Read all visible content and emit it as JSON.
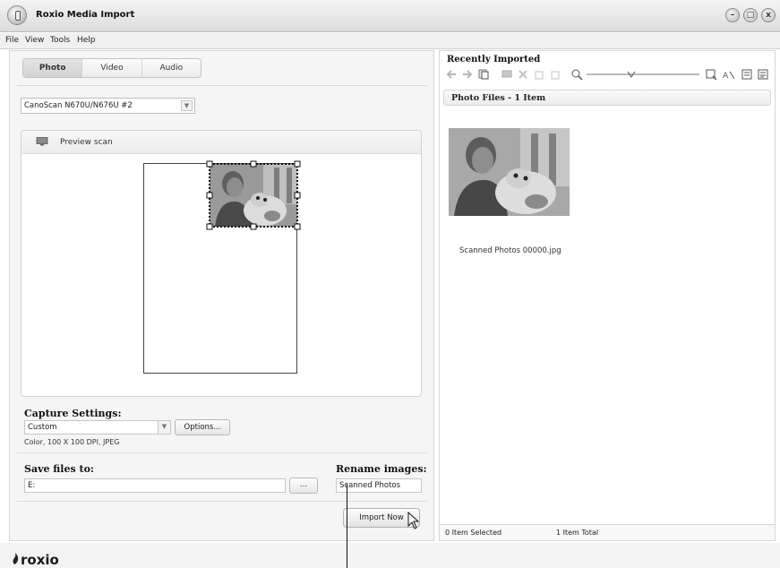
{
  "window": {
    "title": "Roxio Media Import",
    "minimize": "–",
    "maximize": "□",
    "close": "x"
  },
  "menu": [
    "File",
    "View",
    "Tools",
    "Help"
  ],
  "tabs": [
    "Photo",
    "Video",
    "Audio"
  ],
  "device": {
    "selected": "CanoScan N670U/N676U #2",
    "arrow": "▼"
  },
  "preview": {
    "label": "Preview scan"
  },
  "capture": {
    "title": "Capture Settings:",
    "selected": "Custom",
    "arrow": "▼",
    "options_label": "Options...",
    "description": "Color, 100 X 100 DPI, JPEG"
  },
  "save": {
    "title": "Save files to:",
    "value": "E:",
    "browse_label": "...",
    "rename_title": "Rename images:",
    "rename_value": "Scanned Photos",
    "import_label": "Import Now"
  },
  "recent": {
    "title": "Recently Imported",
    "files_header": "Photo Files - 1 Item",
    "file_name": "Scanned Photos 00000.jpg",
    "selected_status": "0 Item Selected",
    "total_status": "1 Item Total"
  },
  "toolbar_icons": [
    "back-arrow-icon",
    "forward-arrow-icon",
    "copy-icon",
    "display-icon",
    "delete-icon",
    "rotate-left-icon",
    "rotate-right-icon",
    "zoom-out-icon",
    "zoom-slider",
    "zoom-in-icon",
    "rename-icon",
    "details-view-icon",
    "list-view-icon"
  ],
  "colors": {
    "panel_bg": "#f5f5f5",
    "border": "#d6d6d6",
    "title_bar": "#dcdcdc"
  },
  "brand": "roxio"
}
